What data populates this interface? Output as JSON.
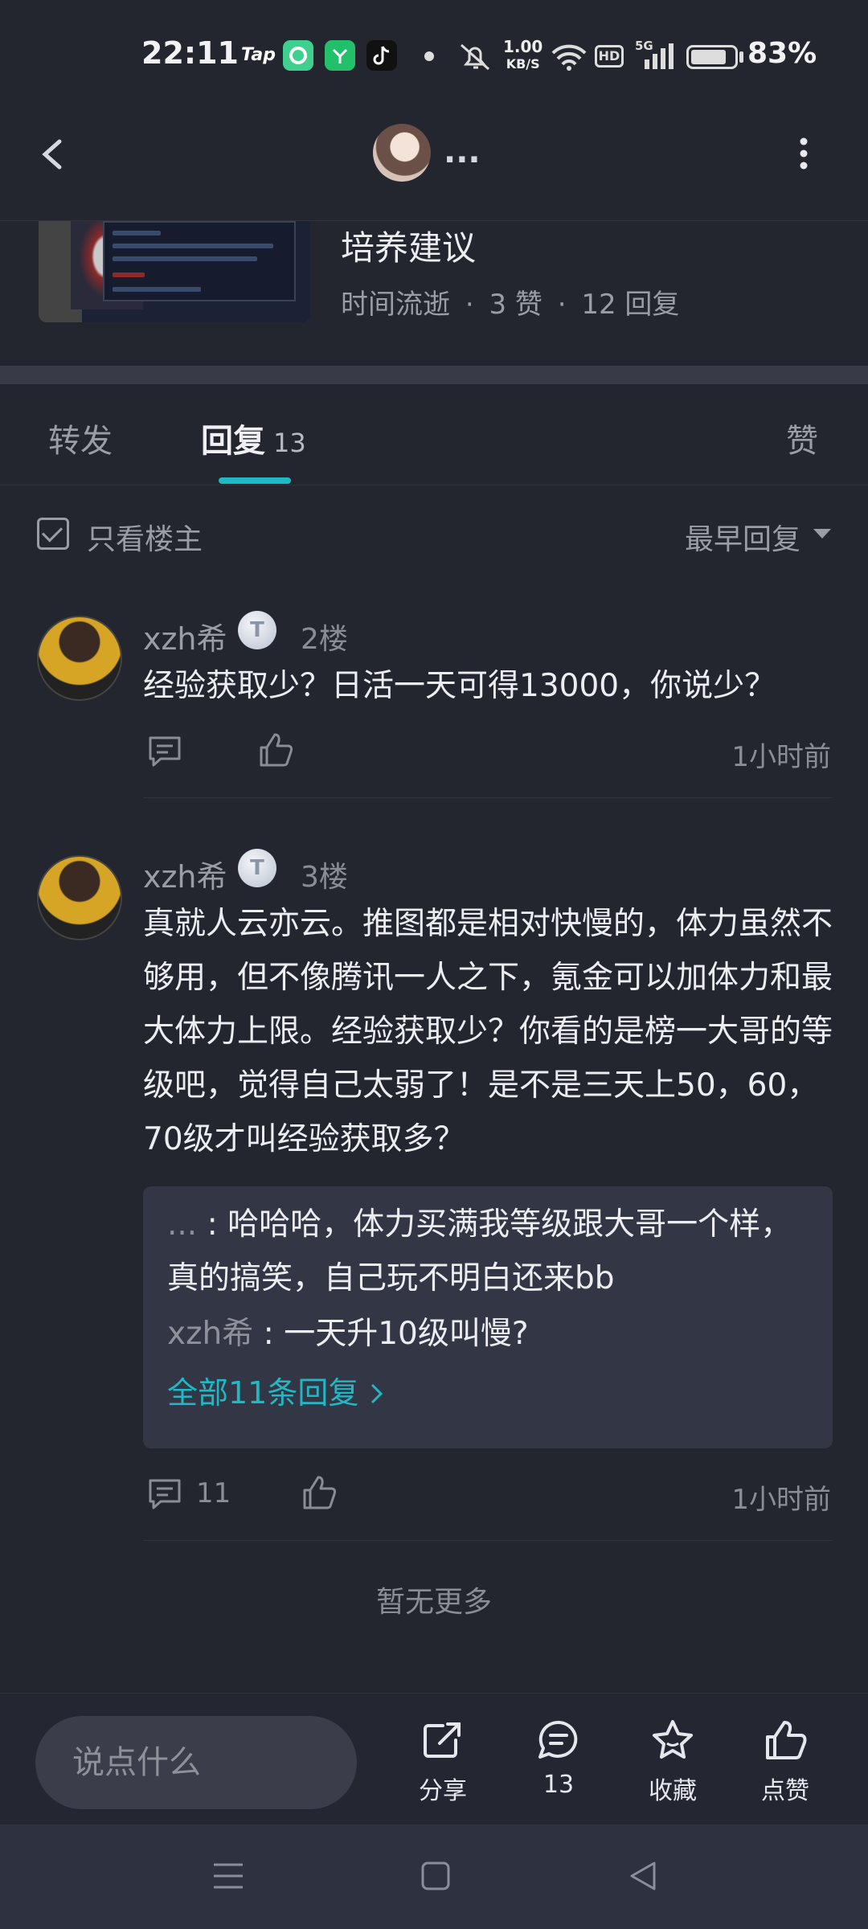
{
  "status_bar": {
    "time": "22:11",
    "tap_label": "Tap",
    "net_speed_value": "1.00",
    "net_speed_unit": "KB/S",
    "hd_label": "HD",
    "signal_label": "5G",
    "battery_level": 0.83,
    "battery_percent": "83%"
  },
  "header": {
    "more_text": "...",
    "back_icon": "chevron-left-icon",
    "menu_icon": "vertical-dots-icon"
  },
  "post": {
    "title": "培养建议",
    "author": "时间流逝",
    "likes": "3 赞",
    "replies": "12 回复"
  },
  "tabs": {
    "forward": "转发",
    "reply": "回复",
    "reply_count": "13",
    "like": "赞"
  },
  "filter": {
    "op_only": "只看楼主",
    "sort": "最早回复"
  },
  "comments": [
    {
      "user": "xzh希",
      "badge": "T",
      "floor": "2楼",
      "body": "经验获取少？日活一天可得13000，你说少？",
      "time": "1小时前"
    },
    {
      "user": "xzh希",
      "badge": "T",
      "floor": "3楼",
      "body": "真就人云亦云。推图都是相对快慢的，体力虽然不够用，但不像腾讯一人之下，氪金可以加体力和最大体力上限。经验获取少？你看的是榜一大哥的等级吧，觉得自己太弱了！是不是三天上50，60，70级才叫经验获取多？",
      "time": "1小时前",
      "comment_count": "11",
      "replies": [
        {
          "who": "...",
          "sep": " : ",
          "text": "哈哈哈，体力买满我等级跟大哥一个样，真的搞笑，自己玩不明白还来bb"
        },
        {
          "who": "xzh希",
          "sep": " : ",
          "text": "一天升10级叫慢?"
        }
      ],
      "all_replies": "全部11条回复"
    }
  ],
  "no_more": "暂无更多",
  "action_bar": {
    "input_placeholder": "说点什么",
    "share": "分享",
    "comments": "13",
    "favorite": "收藏",
    "like": "点赞"
  },
  "colors": {
    "background": "#23252f",
    "accent": "#1fb8c3",
    "reply_box": "#333644"
  }
}
